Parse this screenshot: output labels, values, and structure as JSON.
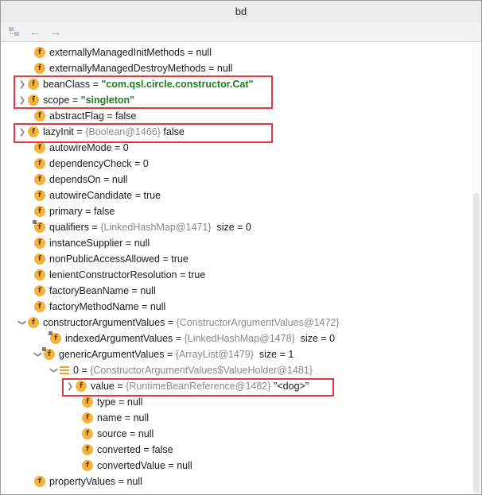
{
  "window": {
    "title": "bd"
  },
  "toolbar": {
    "btn1_icon": "tree-view-icon",
    "back_icon": "back-arrow-icon",
    "forward_icon": "forward-arrow-icon"
  },
  "rows": [
    {
      "name": "externallyManagedInitMethods",
      "value": "null"
    },
    {
      "name": "externallyManagedDestroyMethods",
      "value": "null"
    },
    {
      "name": "beanClass",
      "value": "\"com.qsl.circle.constructor.Cat\""
    },
    {
      "name": "scope",
      "value": "\"singleton\""
    },
    {
      "name": "abstractFlag",
      "value": "false"
    },
    {
      "name": "lazyInit",
      "ref": "{Boolean@1466}",
      "value": "false"
    },
    {
      "name": "autowireMode",
      "value": "0"
    },
    {
      "name": "dependencyCheck",
      "value": "0"
    },
    {
      "name": "dependsOn",
      "value": "null"
    },
    {
      "name": "autowireCandidate",
      "value": "true"
    },
    {
      "name": "primary",
      "value": "false"
    },
    {
      "name": "qualifiers",
      "ref": "{LinkedHashMap@1471}",
      "value": "size = 0"
    },
    {
      "name": "instanceSupplier",
      "value": "null"
    },
    {
      "name": "nonPublicAccessAllowed",
      "value": "true"
    },
    {
      "name": "lenientConstructorResolution",
      "value": "true"
    },
    {
      "name": "factoryBeanName",
      "value": "null"
    },
    {
      "name": "factoryMethodName",
      "value": "null"
    },
    {
      "name": "constructorArgumentValues",
      "ref": "{ConstructorArgumentValues@1472}"
    },
    {
      "name": "indexedArgumentValues",
      "ref": "{LinkedHashMap@1478}",
      "value": "size = 0"
    },
    {
      "name": "genericArgumentValues",
      "ref": "{ArrayList@1479}",
      "value": "size = 1"
    },
    {
      "name": "0",
      "ref": "{ConstructorArgumentValues$ValueHolder@1481}"
    },
    {
      "name": "value",
      "ref": "{RuntimeBeanReference@1482}",
      "value": "\"<dog>\""
    },
    {
      "name": "type",
      "value": "null"
    },
    {
      "name": "name",
      "value": "null"
    },
    {
      "name": "source",
      "value": "null"
    },
    {
      "name": "converted",
      "value": "false"
    },
    {
      "name": "convertedValue",
      "value": "null"
    },
    {
      "name": "propertyValues",
      "value": "null"
    }
  ],
  "icon_letter": "f",
  "eq_sign": "="
}
